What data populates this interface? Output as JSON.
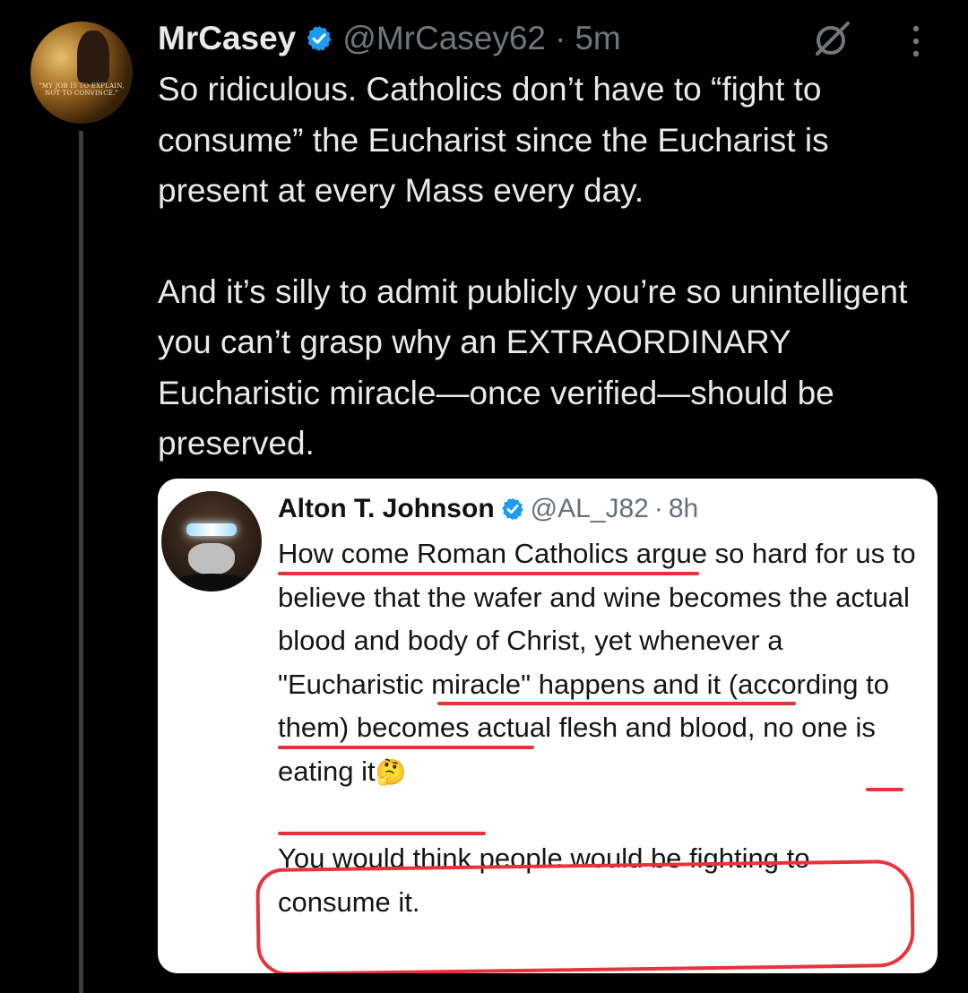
{
  "post": {
    "display_name": "MrCasey",
    "handle": "@MrCasey62",
    "separator": "·",
    "time": "5m",
    "paragraphs": [
      "So ridiculous. Catholics don’t have to “fight to consume” the Eucharist since the Eucharist is present at every Mass every day.",
      "And it’s silly to admit publicly you’re so unintelligent you can’t grasp why an EXTRAORDINARY Eucharistic miracle—once verified—should be preserved."
    ],
    "avatar_quote": "\"MY JOB IS TO EXPLAIN, NOT TO CONVINCE.\""
  },
  "quoted": {
    "display_name": "Alton T. Johnson",
    "handle": "@AL_J82",
    "separator": "·",
    "time": "8h",
    "paragraph1": "How come Roman Catholics argue so hard for us to believe that the wafer and wine becomes the actual blood and body of Christ, yet whenever a \"Eucharistic miracle\" happens and it (according to them) becomes actual flesh and blood, no one is eating it",
    "emoji": "🤔",
    "paragraph2": "You would think people would be fighting to consume it."
  },
  "icons": [
    "verified-badge-icon",
    "grok-icon",
    "more-options-icon"
  ],
  "colors": {
    "background": "#000000",
    "text": "#e7e9ea",
    "secondary": "#71767b",
    "verified": "#1d9bf0",
    "annotation": "#e8323c"
  }
}
